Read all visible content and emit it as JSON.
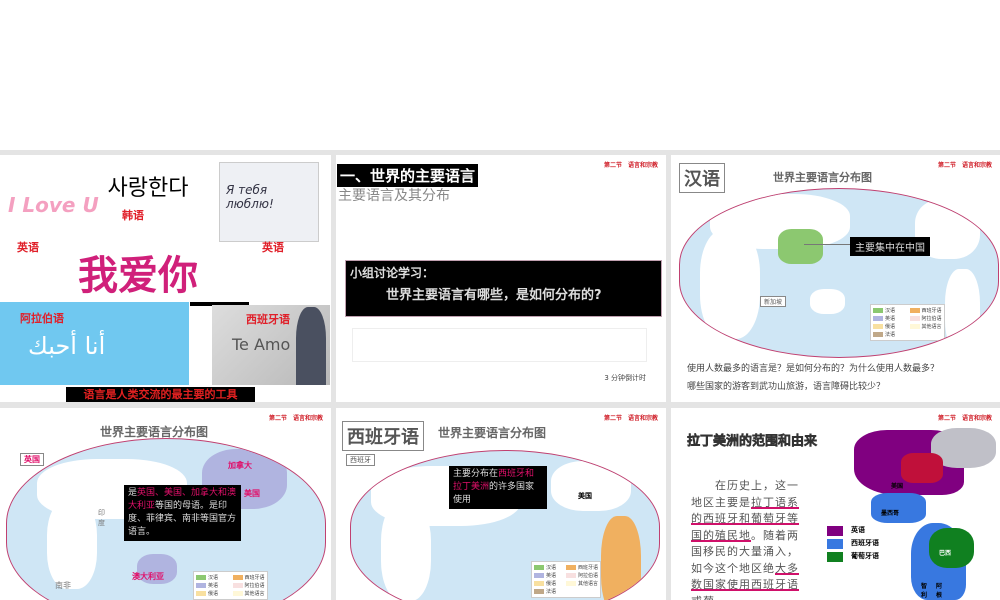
{
  "slides": [
    {
      "labels": {
        "korean": "韩语",
        "english1": "英语",
        "english2": "英语",
        "arabic": "阿拉伯语",
        "spanish": "西班牙语"
      },
      "images": {
        "korean_text": "사랑한다",
        "i_love_u": "I Love U",
        "russian": "Я тебя люблю!",
        "chinese": "我爱你",
        "arabic_text": "أنا أحبك",
        "spanish_text": "Te Amo"
      },
      "caption": "语言是人类交流的最主要的工具"
    },
    {
      "header": "第二节　语言和宗教",
      "title": "一、世界的主要语言",
      "title_shadow": "主要语言及其分布",
      "discussion_label": "小组讨论学习：",
      "discussion_question": "世界主要语言有哪些，是如何分布的?",
      "timer": "3 分钟倒计时"
    },
    {
      "header": "第二节　语言和宗教",
      "tag": "汉语",
      "map_title": "世界主要语言分布图",
      "callout": "主要集中在中国",
      "singapore": "新加坡",
      "question1": "使用人数最多的语言是？是如何分布的？为什么使用人数最多？",
      "question2": "哪些国家的游客到武功山旅游，语言障碍比较少？"
    },
    {
      "header": "第二节　语言和宗教",
      "map_title": "世界主要语言分布图",
      "labels": {
        "uk": "英国",
        "canada": "加拿大",
        "usa": "美国",
        "australia": "澳大利亚",
        "south_africa": "南非",
        "india": "印度"
      },
      "callout_prefix": "是",
      "callout_highlight": "英国、美国、加拿大和澳大利亚",
      "callout_rest": "等国的母语。是印度、菲律宾、南非等国官方语言。"
    },
    {
      "header": "第二节　语言和宗教",
      "tag": "西班牙语",
      "map_title": "世界主要语言分布图",
      "spain": "西班牙",
      "usa": "美国",
      "callout_prefix": "主要分布在",
      "callout_highlight": "西班牙和拉丁美洲",
      "callout_rest": "的许多国家使用"
    },
    {
      "header": "第二节　语言和宗教",
      "title": "拉丁美洲的范围和由来",
      "para_a": "　　在历史上，这一地区主要是",
      "para_u1": "拉丁语系的西班牙和葡萄牙等国的殖民地",
      "para_b": "。随着两国移民的大量涌入，如今这个地区绝",
      "para_u2": "大多数国家使用西班牙语或葡",
      "legend": [
        "英语",
        "西班牙语",
        "葡萄牙语"
      ],
      "map_labels": {
        "usa": "美国",
        "mexico": "墨西哥",
        "brazil": "巴西",
        "chile": "智利",
        "argentina": "阿根"
      }
    }
  ],
  "legend_items": [
    "汉语",
    "西班牙语",
    "英语",
    "阿拉伯语",
    "俄语",
    "其他语言",
    "法语"
  ],
  "colors": {
    "chinese": "#8cc870",
    "spanish": "#f0b060",
    "english": "#b0b4e0",
    "arabic": "#f8e0e0",
    "russian": "#f8e0a0",
    "other": "#fff8d8",
    "french": "#c0a888"
  }
}
